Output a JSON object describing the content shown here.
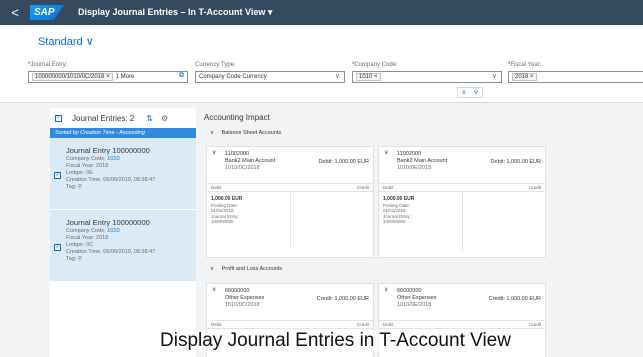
{
  "shell": {
    "back_label": "<",
    "logo_text": "SAP",
    "app_title": "Display Journal Entries – In T-Account View ▾"
  },
  "header": {
    "variant": "Standard",
    "variant_chevron": "∨",
    "fields": {
      "journal_entry": {
        "required": "*",
        "label": "Journal Entry:",
        "token": "100000000/1010/0C/2018 ×",
        "more": "1 More",
        "icon": "⧉"
      },
      "currency_type": {
        "label": "Currency Type:",
        "value": "Company Code Currency",
        "icon": "∨"
      },
      "company_code": {
        "required": "*",
        "label": "Company Code:",
        "token": "1010 ×",
        "icon": "∨"
      },
      "fiscal_year": {
        "required": "*",
        "label": "Fiscal Year:",
        "token": "2018 ×"
      }
    },
    "collapse_icons": [
      "∧",
      "⚲"
    ]
  },
  "left": {
    "select_all": "✓",
    "title": "Journal Entries: 2",
    "sort_icon": "⇅",
    "settings_icon": "⚙",
    "sort_bar": "Sorted by Creation Time - Ascending",
    "entries": [
      {
        "checkbox": "✓",
        "title": "Journal Entry 100000000",
        "company_label": "Company Code: ",
        "company_code": "1010",
        "fiscal_year": "Fiscal Year: 2018",
        "ledger": "Ledger: 0E",
        "creation_time": "Creation Time: 06/06/2019, 08:38:47",
        "tag": "Tag: ⚲"
      },
      {
        "checkbox": "✓",
        "title": "Journal Entry 100000000",
        "company_label": "Company Code: ",
        "company_code": "1010",
        "fiscal_year": "Fiscal Year: 2018",
        "ledger": "Ledger: 0C",
        "creation_time": "Creation Time: 06/06/2019, 08:38:47",
        "tag": "Tag: ⚲"
      }
    ]
  },
  "main": {
    "title": "Accounting Impact",
    "section_chevron": "∨",
    "sections": {
      "balance": "Balance Sheet Accounts",
      "pnl": "Profit and Loss Accounts"
    },
    "balance_cards": [
      {
        "chevron": "∨",
        "account": "11002000",
        "name": "Bank2 Main Account",
        "ref": "1010/0C/2018",
        "amount": "Debit: 1,000.00 EUR",
        "debit": "Debit",
        "credit": "Credit",
        "balance": "1,000.00 EUR",
        "posting_label": "Posting Date:",
        "posting_date": "01/01/2018",
        "je_label": "Journal Entry:",
        "je_number": "100000000"
      },
      {
        "chevron": "∨",
        "account": "11002000",
        "name": "Bank2 Main Account",
        "ref": "1010/0E/2018",
        "amount": "Debit: 1,000.00 EUR",
        "debit": "Debit",
        "credit": "Credit",
        "balance": "1,000.00 EUR",
        "posting_label": "Posting Date:",
        "posting_date": "01/01/2018",
        "je_label": "Journal Entry:",
        "je_number": "100000000"
      }
    ],
    "pnl_cards": [
      {
        "chevron": "∨",
        "account": "66000000",
        "name": "Other Expenses",
        "ref": "1010/0C/2018",
        "amount": "Credit: 1,000.00 EUR",
        "debit": "Debit",
        "credit": "Credit"
      },
      {
        "chevron": "∨",
        "account": "66000000",
        "name": "Other Expenses",
        "ref": "1010/0E/2018",
        "amount": "Credit: 1,000.00 EUR",
        "debit": "Debit",
        "credit": "Credit"
      }
    ]
  },
  "caption": "Display Journal Entries in T-Account View"
}
